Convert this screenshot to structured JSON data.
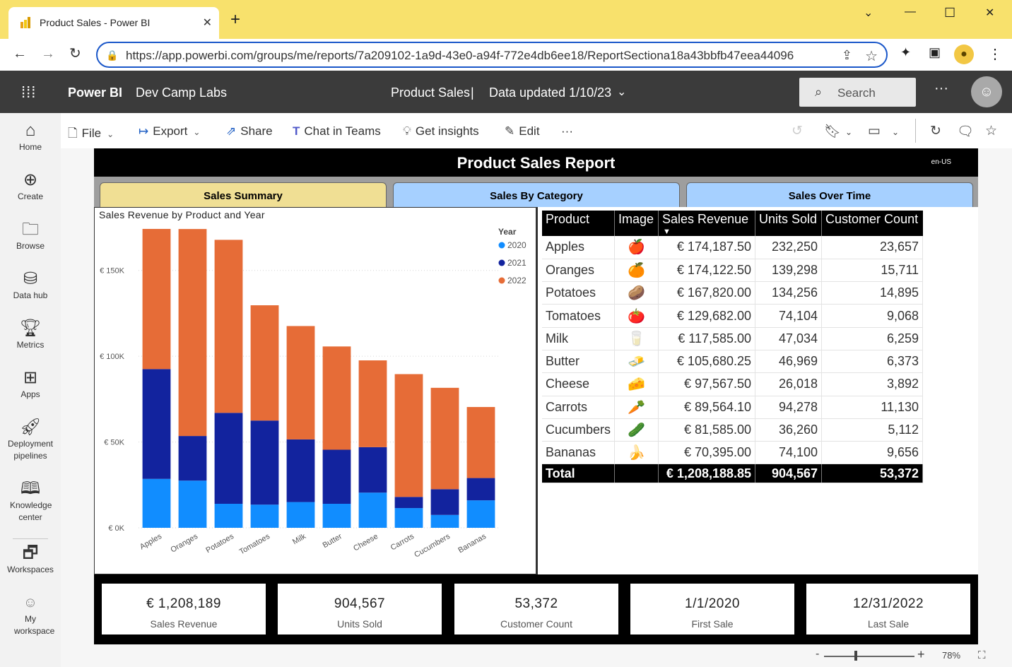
{
  "browser": {
    "tab_title": "Product Sales - Power BI",
    "url": "https://app.powerbi.com/groups/me/reports/7a209102-1a9d-43e0-a94f-772e4db6ee18/ReportSectiona18a43bbfb47eea44096"
  },
  "header": {
    "brand": "Power BI",
    "workspace": "Dev Camp Labs",
    "report_name": "Product Sales",
    "separator": "|",
    "data_updated": "Data updated 1/10/23",
    "search_placeholder": "Search"
  },
  "leftnav": {
    "items": [
      {
        "label": "Home"
      },
      {
        "label": "Create"
      },
      {
        "label": "Browse"
      },
      {
        "label": "Data hub"
      },
      {
        "label": "Metrics"
      },
      {
        "label": "Apps"
      },
      {
        "label": "Deployment pipelines"
      },
      {
        "label": "Knowledge center"
      },
      {
        "label": "Workspaces"
      },
      {
        "label": "My workspace"
      }
    ]
  },
  "actionbar": {
    "file": "File",
    "export": "Export",
    "share": "Share",
    "chat": "Chat in Teams",
    "insights": "Get insights",
    "edit": "Edit"
  },
  "report": {
    "title": "Product Sales Report",
    "locale": "en-US",
    "tabs": [
      {
        "label": "Sales Summary",
        "color": "#f0df94"
      },
      {
        "label": "Sales By Category",
        "color": "#a6d0ff"
      },
      {
        "label": "Sales Over Time",
        "color": "#a6d0ff"
      }
    ]
  },
  "chart_data": {
    "type": "bar",
    "stacked": true,
    "title": "Sales Revenue by Product and Year",
    "legend_title": "Year",
    "legend_position": "top-right",
    "categories": [
      "Apples",
      "Oranges",
      "Potatoes",
      "Tomatoes",
      "Milk",
      "Butter",
      "Cheese",
      "Carrots",
      "Cucumbers",
      "Bananas"
    ],
    "series": [
      {
        "name": "2020",
        "color": "#118dff",
        "values": [
          28500,
          27500,
          14000,
          13500,
          15000,
          14000,
          20500,
          11500,
          7500,
          16000
        ]
      },
      {
        "name": "2021",
        "color": "#12239e",
        "values": [
          64000,
          26000,
          53000,
          49000,
          36500,
          31500,
          26500,
          6500,
          15000,
          13000
        ]
      },
      {
        "name": "2022",
        "color": "#e66c37",
        "values": [
          81687.5,
          120622.5,
          100820,
          67182,
          66085,
          60180.25,
          50567.5,
          71564.1,
          59085,
          41395
        ]
      }
    ],
    "ylim": [
      0,
      175000
    ],
    "yticks": [
      0,
      50000,
      100000,
      150000
    ],
    "ytick_labels": [
      "€ 0K",
      "€ 50K",
      "€ 100K",
      "€ 150K"
    ],
    "grid": true
  },
  "table": {
    "columns": [
      "Product",
      "Image",
      "Sales Revenue",
      "Units Sold",
      "Customer Count"
    ],
    "rows": [
      {
        "product": "Apples",
        "icon": "apple-icon",
        "glyph": "🍎",
        "revenue": "€ 174,187.50",
        "units": "232,250",
        "customers": "23,657"
      },
      {
        "product": "Oranges",
        "icon": "orange-icon",
        "glyph": "🍊",
        "revenue": "€ 174,122.50",
        "units": "139,298",
        "customers": "15,711"
      },
      {
        "product": "Potatoes",
        "icon": "potato-icon",
        "glyph": "🥔",
        "revenue": "€ 167,820.00",
        "units": "134,256",
        "customers": "14,895"
      },
      {
        "product": "Tomatoes",
        "icon": "tomato-icon",
        "glyph": "🍅",
        "revenue": "€ 129,682.00",
        "units": "74,104",
        "customers": "9,068"
      },
      {
        "product": "Milk",
        "icon": "milk-icon",
        "glyph": "🥛",
        "revenue": "€ 117,585.00",
        "units": "47,034",
        "customers": "6,259"
      },
      {
        "product": "Butter",
        "icon": "butter-icon",
        "glyph": "🧈",
        "revenue": "€ 105,680.25",
        "units": "46,969",
        "customers": "6,373"
      },
      {
        "product": "Cheese",
        "icon": "cheese-icon",
        "glyph": "🧀",
        "revenue": "€ 97,567.50",
        "units": "26,018",
        "customers": "3,892"
      },
      {
        "product": "Carrots",
        "icon": "carrot-icon",
        "glyph": "🥕",
        "revenue": "€ 89,564.10",
        "units": "94,278",
        "customers": "11,130"
      },
      {
        "product": "Cucumbers",
        "icon": "cucumber-icon",
        "glyph": "🥒",
        "revenue": "€ 81,585.00",
        "units": "36,260",
        "customers": "5,112"
      },
      {
        "product": "Bananas",
        "icon": "banana-icon",
        "glyph": "🍌",
        "revenue": "€ 70,395.00",
        "units": "74,100",
        "customers": "9,656"
      }
    ],
    "total": {
      "label": "Total",
      "revenue": "€ 1,208,188.85",
      "units": "904,567",
      "customers": "53,372"
    }
  },
  "cards": [
    {
      "value": "€ 1,208,189",
      "caption": "Sales Revenue"
    },
    {
      "value": "904,567",
      "caption": "Units Sold"
    },
    {
      "value": "53,372",
      "caption": "Customer Count"
    },
    {
      "value": "1/1/2020",
      "caption": "First Sale"
    },
    {
      "value": "12/31/2022",
      "caption": "Last Sale"
    }
  ],
  "status": {
    "zoom": "78%",
    "zoom_fraction": 0.35
  }
}
